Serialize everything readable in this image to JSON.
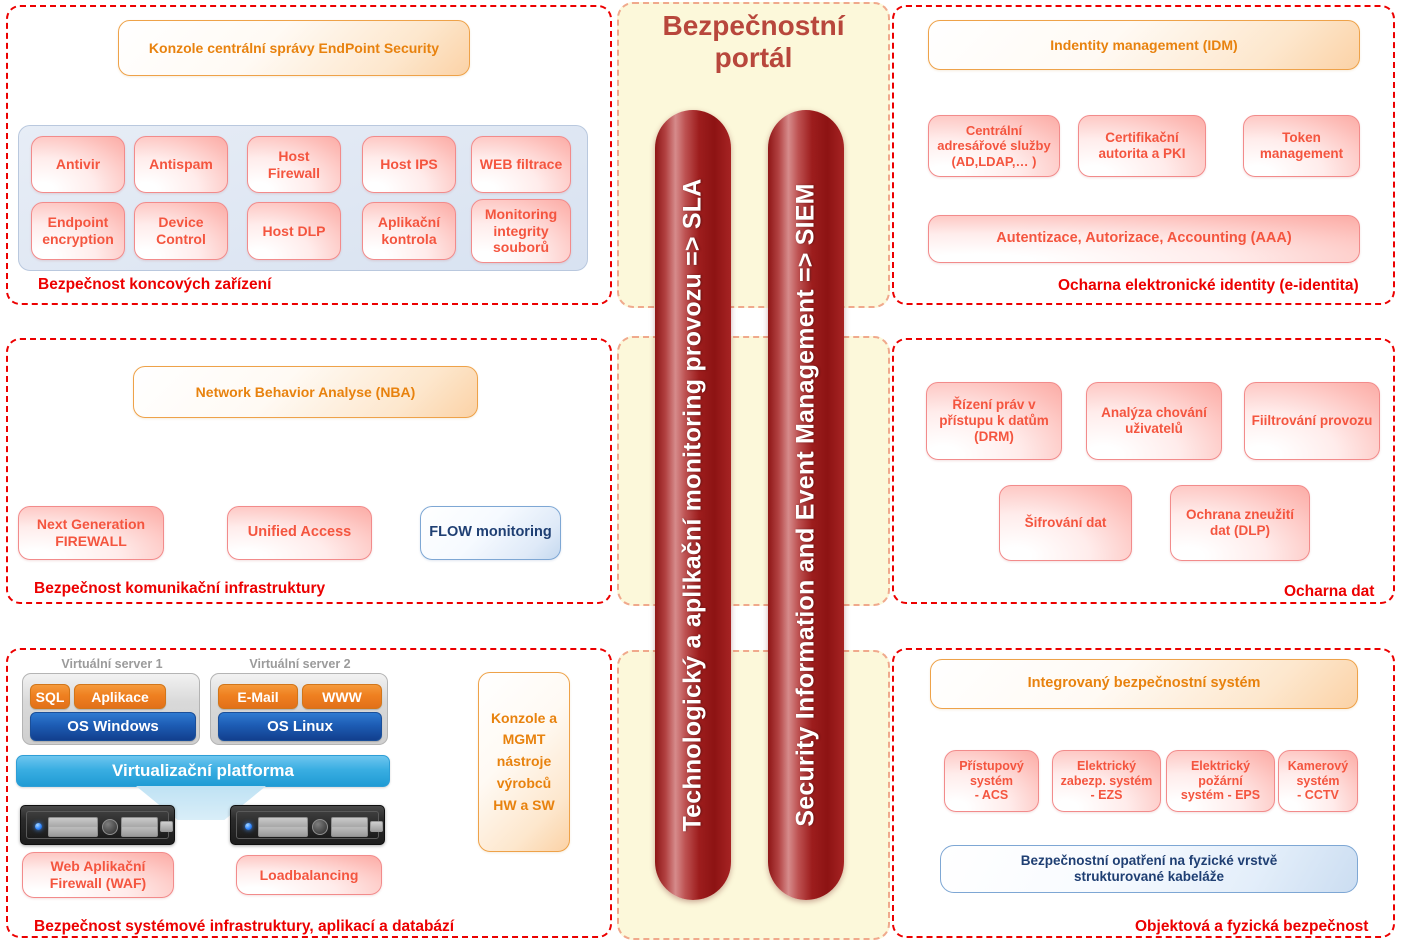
{
  "center": {
    "title": "Bezpečnostní\nportál",
    "pills": [
      {
        "name": "sla-pill",
        "label": "Technologický a aplikační monitoring provozu => SLA"
      },
      {
        "name": "siem-pill",
        "label": "Security Information and Event Management => SIEM"
      }
    ]
  },
  "panels": {
    "endpoint": {
      "caption": "Bezpečnost koncových zařízení",
      "console": "Konzole centrální správy EndPoint Security",
      "tiles_row1": [
        "Antivir",
        "Antispam",
        "Host\nFirewall",
        "Host IPS",
        "WEB filtrace"
      ],
      "tiles_row2": [
        "Endpoint\nencryption",
        "Device\nControl",
        "Host DLP",
        "Aplikační\nkontrola",
        "Monitoring\nintegrity\nsouborů"
      ]
    },
    "identity": {
      "caption": "Ocharna elektronické identity (e-identita)",
      "idm": "Indentity management (IDM)",
      "middle": [
        "Centrální\nadresářové služby\n(AD,LDAP,… )",
        "Certifikační\nautorita a PKI",
        "Token\nmanagement"
      ],
      "aaa": "Autentizace, Autorizace, Accounting (AAA)"
    },
    "network": {
      "caption": "Bezpečnost komunikační infrastruktury",
      "nba": "Network Behavior Analyse (NBA)",
      "firewall": "Next Generation\nFIREWALL",
      "unified_access": "Unified Access",
      "flow": "FLOW monitoring"
    },
    "data": {
      "caption": "Ocharna dat",
      "tiles_row1": [
        "Řízení práv v\npřístupu k datům\n(DRM)",
        "Analýza chování\nuživatelů",
        "Fiiltrování provozu"
      ],
      "tiles_row2": [
        "Šifrování dat",
        "Ochrana zneužití\ndat (DLP)"
      ]
    },
    "systems": {
      "caption": "Bezpečnost systémové infrastruktury, aplikací a databází",
      "server1_label": "Virtuální server 1",
      "server2_label": "Virtuální server 2",
      "server1_apps": [
        "SQL",
        "Aplikace"
      ],
      "server1_os": "OS Windows",
      "server2_apps": [
        "E-Mail",
        "WWW"
      ],
      "server2_os": "OS Linux",
      "virt_platform": "Virtualizační    platforma",
      "waf": "Web Aplikační\nFirewall (WAF)",
      "loadbalancing": "Loadbalancing",
      "console_mgmt": "Konzole a\nMGMT\nnástroje\nvýrobců\nHW a SW"
    },
    "physical": {
      "caption": "Objektová a fyzická bezpečnost",
      "integrated": "Integrovaný bezpečnostní systém",
      "tiles": [
        "Přístupový\nsystém\n- ACS",
        "Elektrický\nzabezp. systém\n- EZS",
        "Elektrický\npožární\nsystém - EPS",
        "Kamerový\nsystém\n- CCTV"
      ],
      "cabling": "Bezpečnostní opatření na fyzické vrstvě\nstrukturované kabeláže"
    }
  },
  "colors": {
    "panel_border": "#ec0000",
    "caption": "#ec0000",
    "red_node_text": "#f4553f",
    "orange_node_text": "#e8820e",
    "blue_node_text": "#1f3f73",
    "center_bg": "#fcf8da",
    "center_border": "#f0a98c",
    "center_title": "#b8473c",
    "pill_dark": "#8e1616",
    "arrow_red": "#f4553f",
    "arrow_navy": "#1f3160"
  }
}
